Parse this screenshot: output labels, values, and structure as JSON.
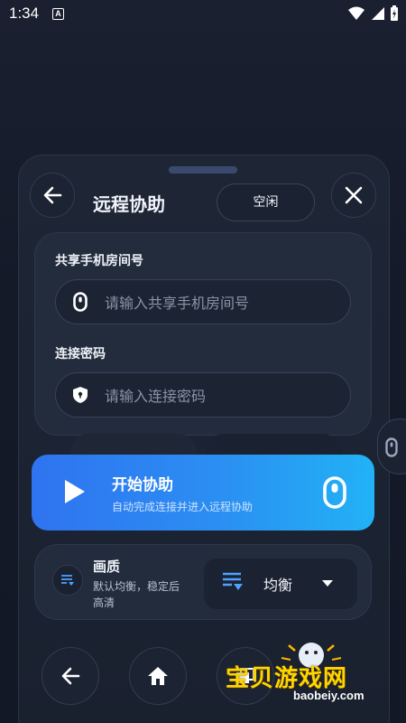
{
  "status_bar": {
    "time": "1:34",
    "badge": "A"
  },
  "header": {
    "title": "远程协助",
    "status": "空闲",
    "back_icon": "arrow-left-icon",
    "close_icon": "close-icon"
  },
  "form": {
    "room_label": "共享手机房间号",
    "room_placeholder": "请输入共享手机房间号",
    "password_label": "连接密码",
    "password_placeholder": "请输入连接密码"
  },
  "start": {
    "title": "开始协助",
    "subtitle": "自动完成连接并进入远程协助"
  },
  "quality": {
    "title": "画质",
    "description": "默认均衡，稳定后高清",
    "value": "均衡"
  },
  "watermark": {
    "title": "宝贝游戏网",
    "url": "baobeiy.com"
  },
  "colors": {
    "accent_start": "#2f73f0",
    "accent_end": "#22b2f6",
    "background": "#141a28"
  }
}
